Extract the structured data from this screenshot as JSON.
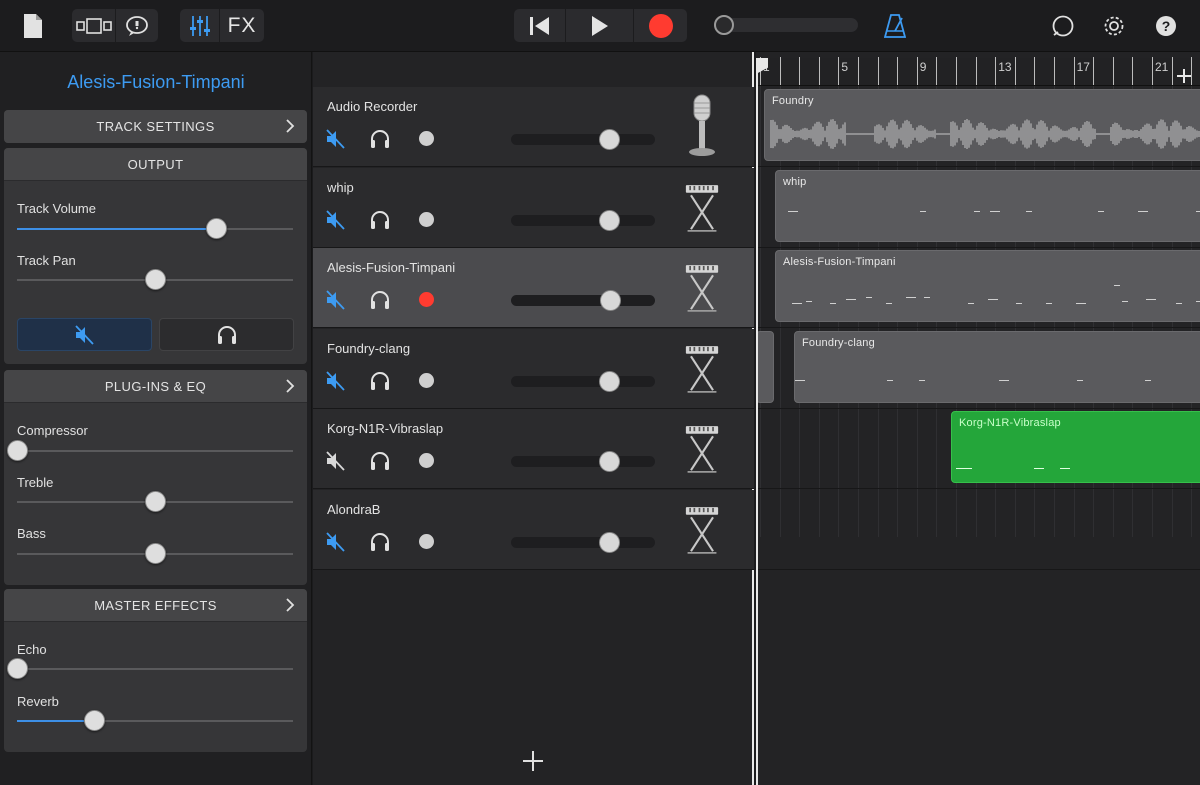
{
  "toolbar": {
    "fx_label": "FX",
    "icons": [
      "document-icon",
      "view-toggle-icon",
      "chat-icon",
      "mixer-icon",
      "rewind-icon",
      "play-icon",
      "record-icon",
      "metronome-icon",
      "loop-icon",
      "settings-icon",
      "help-icon"
    ],
    "accent_color": "#3d9bf2",
    "record_color": "#ff3b30"
  },
  "inspector": {
    "title": "Alesis-Fusion-Timpani",
    "track_settings": "TRACK SETTINGS",
    "output": {
      "header": "OUTPUT",
      "track_volume_label": "Track Volume",
      "track_volume_value": 0.72,
      "track_pan_label": "Track Pan",
      "track_pan_value": 0.5
    },
    "plugins": {
      "header": "PLUG-INS & EQ",
      "compressor_label": "Compressor",
      "compressor_value": 0.0,
      "treble_label": "Treble",
      "treble_value": 0.5,
      "bass_label": "Bass",
      "bass_value": 0.5
    },
    "master": {
      "header": "MASTER EFFECTS",
      "echo_label": "Echo",
      "echo_value": 0.0,
      "reverb_label": "Reverb",
      "reverb_value": 0.28
    }
  },
  "tracks": [
    {
      "name": "Audio Recorder",
      "muted": true,
      "instrument": "microphone-icon",
      "volume": 0.68,
      "record_armed": false,
      "selected": false
    },
    {
      "name": "whip",
      "muted": true,
      "instrument": "keyboard-icon",
      "volume": 0.68,
      "record_armed": false,
      "selected": false
    },
    {
      "name": "Alesis-Fusion-Timpani",
      "muted": true,
      "instrument": "keyboard-icon",
      "volume": 0.69,
      "record_armed": true,
      "selected": true
    },
    {
      "name": "Foundry-clang",
      "muted": true,
      "instrument": "keyboard-icon",
      "volume": 0.68,
      "record_armed": false,
      "selected": false
    },
    {
      "name": "Korg-N1R-Vibraslap",
      "muted": false,
      "instrument": "keyboard-icon",
      "volume": 0.68,
      "record_armed": false,
      "selected": false
    },
    {
      "name": "AlondraB",
      "muted": true,
      "instrument": "keyboard-icon",
      "volume": 0.68,
      "record_armed": false,
      "selected": false
    }
  ],
  "timeline": {
    "bar_numbers": [
      "1",
      "5",
      "9",
      "13",
      "17",
      "21"
    ],
    "regions": [
      {
        "name": "Foundry",
        "type": "audio"
      },
      {
        "name": "whip",
        "type": "midi"
      },
      {
        "name": "Alesis-Fusion-Timpani",
        "type": "midi"
      },
      {
        "name": "Foundry-clang",
        "type": "midi"
      },
      {
        "name": "Korg-N1R-Vibraslap",
        "type": "midi-green"
      }
    ]
  }
}
